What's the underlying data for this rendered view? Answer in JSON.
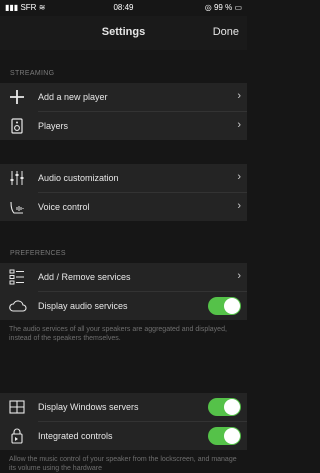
{
  "status_bar": {
    "carrier": "SFR",
    "time": "08:49",
    "battery": "99 %"
  },
  "nav": {
    "title": "Settings",
    "done_label": "Done"
  },
  "sections": {
    "streaming": {
      "header": "STREAMING",
      "items": [
        {
          "label": "Add a new player",
          "icon": "plus-icon"
        },
        {
          "label": "Players",
          "icon": "speaker-icon"
        }
      ]
    },
    "audio": {
      "items": [
        {
          "label": "Audio customization",
          "icon": "equalizer-icon"
        },
        {
          "label": "Voice control",
          "icon": "voice-icon"
        }
      ]
    },
    "preferences": {
      "header": "PREFERENCES",
      "items": [
        {
          "label": "Add / Remove services",
          "icon": "list-icon"
        },
        {
          "label": "Display audio services",
          "icon": "cloud-icon",
          "toggle": true
        }
      ],
      "footnote": "The audio services of all your speakers are aggregated and displayed, instead of the speakers themselves."
    },
    "windows": {
      "items": [
        {
          "label": "Display Windows servers",
          "icon": "windows-icon",
          "toggle": true
        },
        {
          "label": "Integrated controls",
          "icon": "lockscreen-icon",
          "toggle": true
        }
      ],
      "footnote": "Allow the music control of your speaker from the lockscreen, and manage its volume using the hardware"
    }
  },
  "colors": {
    "toggle_on": "#55c249",
    "background": "#161616",
    "row": "#242424"
  }
}
